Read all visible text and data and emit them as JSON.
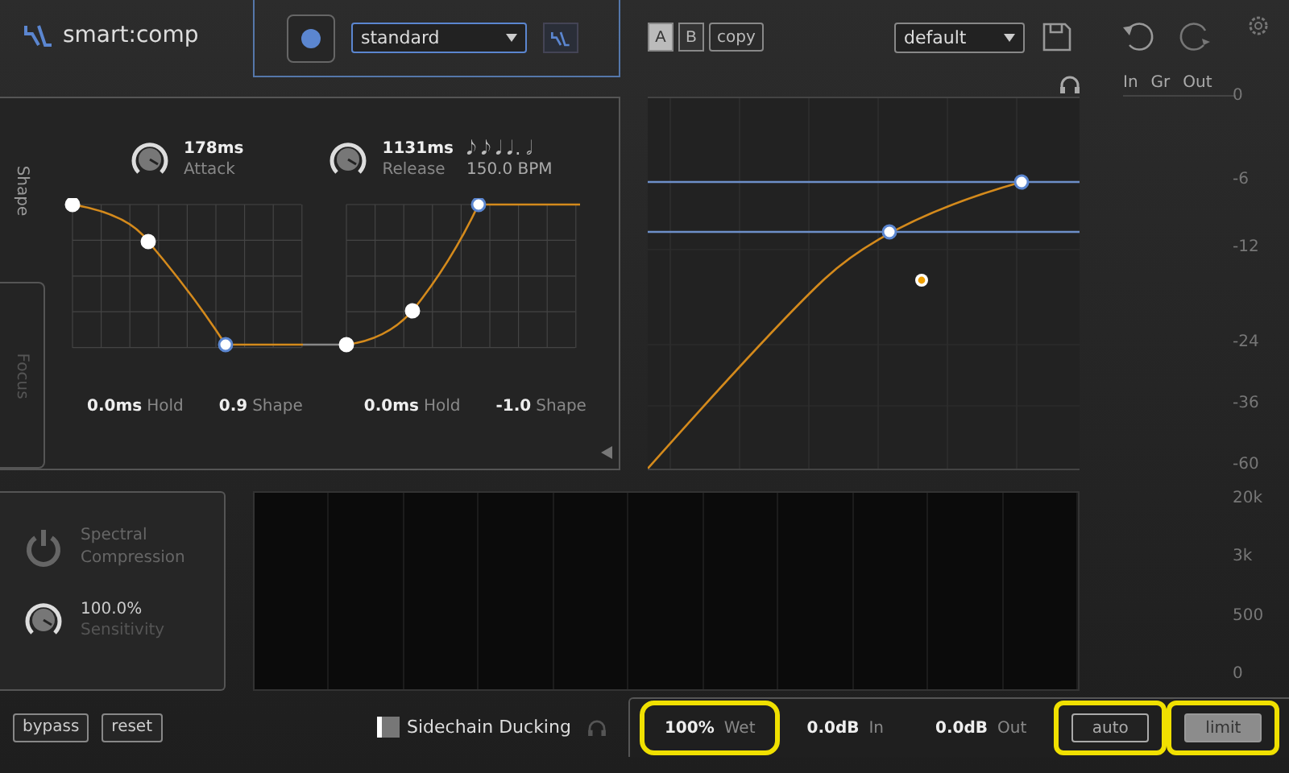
{
  "app": {
    "name": "smart:comp"
  },
  "preset_bar": {
    "profile": "standard"
  },
  "ab": {
    "slots": [
      {
        "label": "A",
        "selected": true
      },
      {
        "label": "B",
        "selected": false
      }
    ],
    "copy": "copy"
  },
  "preset": "default",
  "side_tabs": [
    {
      "label": "Shape",
      "selected": true
    },
    {
      "label": "Focus",
      "selected": false
    }
  ],
  "attack": {
    "value": "178ms",
    "label": "Attack"
  },
  "release": {
    "value": "1131ms",
    "label": "Release",
    "notes": [
      "𝅘𝅥𝅮",
      "𝅘𝅥𝅮",
      "𝅘𝅥",
      "𝅘𝅥.",
      "𝅗𝅥"
    ],
    "bpm": "150.0 BPM"
  },
  "shape_params": [
    {
      "value": "0.0ms",
      "label": "Hold"
    },
    {
      "value": "0.9",
      "label": "Shape"
    },
    {
      "value": "0.0ms",
      "label": "Hold"
    },
    {
      "value": "-1.0",
      "label": "Shape"
    }
  ],
  "meters": {
    "labels": [
      "In",
      "Gr",
      "Out"
    ]
  },
  "db_scale": [
    "0",
    "-6",
    "-12",
    "-24",
    "-36",
    "-60"
  ],
  "freq_scale": [
    "20k",
    "3k",
    "500",
    "0"
  ],
  "spectral": {
    "title": "Spectral Compression",
    "on": false,
    "value": "100.0%",
    "label": "Sensitivity"
  },
  "footer": {
    "buttons": [
      "bypass",
      "reset"
    ],
    "sidechain": {
      "label": "Sidechain Ducking",
      "on": false
    }
  },
  "output": [
    {
      "value": "100%",
      "label": "Wet",
      "highlighted": true
    },
    {
      "value": "0.0dB",
      "label": "In",
      "highlighted": false
    },
    {
      "value": "0.0dB",
      "label": "Out",
      "highlighted": false
    }
  ],
  "output_buttons": [
    {
      "label": "auto",
      "on": false,
      "highlighted": true
    },
    {
      "label": "limit",
      "on": true,
      "highlighted": true
    }
  ]
}
